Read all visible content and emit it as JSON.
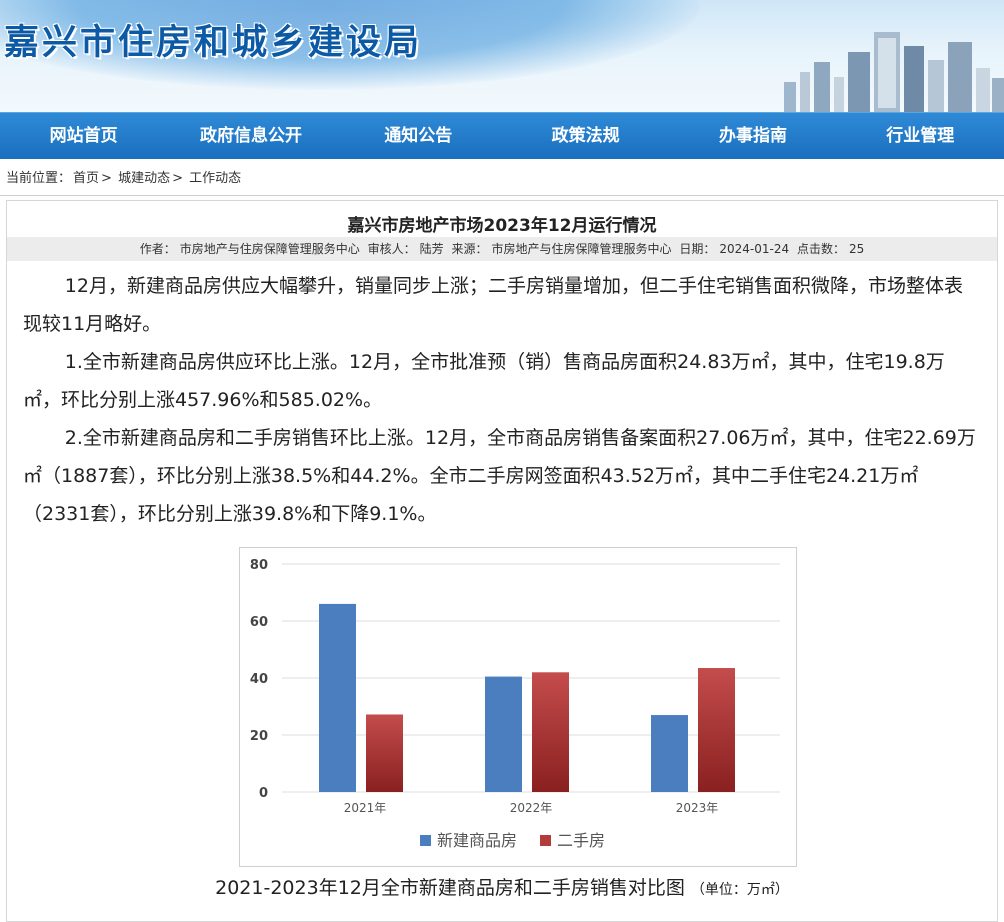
{
  "site": {
    "title": "嘉兴市住房和城乡建设局"
  },
  "nav": {
    "items": [
      "网站首页",
      "政府信息公开",
      "通知公告",
      "政策法规",
      "办事指南",
      "行业管理"
    ]
  },
  "breadcrumb": {
    "prefix": "当前位置：",
    "items": [
      "首页",
      "城建动态",
      "工作动态"
    ],
    "sep": ">"
  },
  "article": {
    "title": "嘉兴市房地产市场2023年12月运行情况",
    "meta": {
      "author_label": "作者：",
      "author": "市房地产与住房保障管理服务中心",
      "reviewer_label": "审核人：",
      "reviewer": "陆芳",
      "source_label": "来源：",
      "source": "市房地产与住房保障管理服务中心",
      "date_label": "日期：",
      "date": "2024-01-24",
      "hits_label": "点击数：",
      "hits": "25"
    },
    "paragraphs": [
      "12月，新建商品房供应大幅攀升，销量同步上涨；二手房销量增加，但二手住宅销售面积微降，市场整体表现较11月略好。",
      "1.全市新建商品房供应环比上涨。12月，全市批准预（销）售商品房面积24.83万㎡，其中，住宅19.8万㎡，环比分别上涨457.96%和585.02%。",
      "2.全市新建商品房和二手房销售环比上涨。12月，全市商品房销售备案面积27.06万㎡，其中，住宅22.69万㎡（1887套），环比分别上涨38.5%和44.2%。全市二手房网签面积43.52万㎡，其中二手住宅24.21万㎡（2331套），环比分别上涨39.8%和下降9.1%。"
    ],
    "caption": "2021-2023年12月全市新建商品房和二手房销售对比图",
    "caption_unit": "（单位：万㎡）"
  },
  "chart_data": {
    "type": "bar",
    "categories": [
      "2021年",
      "2022年",
      "2023年"
    ],
    "series": [
      {
        "name": "新建商品房",
        "values": [
          66,
          40.5,
          27
        ],
        "color": "#4a7ebf"
      },
      {
        "name": "二手房",
        "values": [
          27.2,
          42,
          43.5
        ],
        "color": "#b23b3b"
      }
    ],
    "yticks": [
      0,
      20,
      40,
      60,
      80
    ],
    "ylim": [
      0,
      80
    ],
    "grid": true,
    "legend": "bottom"
  }
}
